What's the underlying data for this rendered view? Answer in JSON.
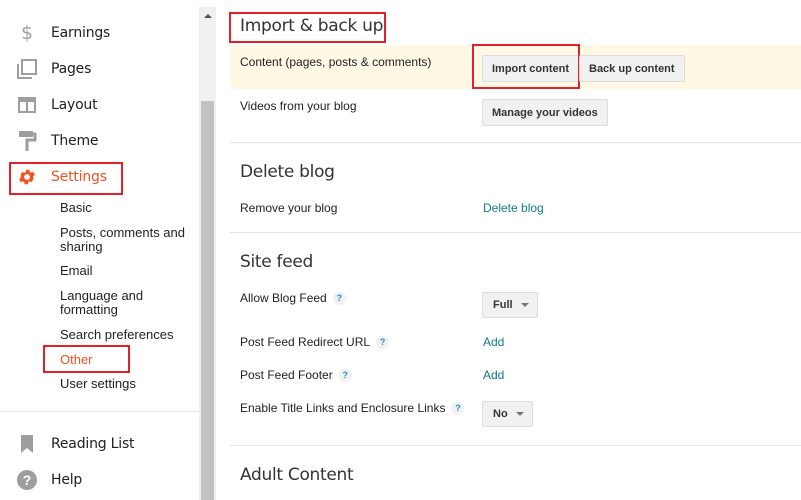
{
  "colors": {
    "accent": "#f4511e",
    "link": "#0e7c86",
    "highlight_row": "#fff8e5",
    "annotation_box": "#e2202a"
  },
  "sidebar": {
    "items": [
      {
        "label": "Earnings",
        "icon": "dollar-icon"
      },
      {
        "label": "Pages",
        "icon": "pages-icon"
      },
      {
        "label": "Layout",
        "icon": "layout-icon"
      },
      {
        "label": "Theme",
        "icon": "paint-roller-icon"
      },
      {
        "label": "Settings",
        "icon": "gear-icon",
        "active": true
      }
    ],
    "settings_sub": [
      {
        "label": "Basic"
      },
      {
        "label": "Posts, comments and sharing"
      },
      {
        "label": "Email"
      },
      {
        "label": "Language and formatting"
      },
      {
        "label": "Search preferences"
      },
      {
        "label": "Other",
        "active": true
      },
      {
        "label": "User settings"
      }
    ],
    "bottom_items": [
      {
        "label": "Reading List",
        "icon": "bookmark-icon"
      },
      {
        "label": "Help",
        "icon": "help-icon"
      }
    ]
  },
  "main": {
    "import_backup": {
      "title": "Import & back up",
      "content_label": "Content (pages, posts & comments)",
      "import_button": "Import content",
      "backup_button": "Back up content",
      "videos_label": "Videos from your blog",
      "manage_videos_button": "Manage your videos"
    },
    "delete_blog": {
      "title": "Delete blog",
      "remove_label": "Remove your blog",
      "delete_link": "Delete blog"
    },
    "site_feed": {
      "title": "Site feed",
      "allow_feed_label": "Allow Blog Feed",
      "allow_feed_value": "Full",
      "redirect_label": "Post Feed Redirect URL",
      "redirect_link": "Add",
      "footer_label": "Post Feed Footer",
      "footer_link": "Add",
      "title_links_label": "Enable Title Links and Enclosure Links",
      "title_links_value": "No",
      "help_glyph": "?"
    },
    "adult_content": {
      "title": "Adult Content"
    }
  }
}
